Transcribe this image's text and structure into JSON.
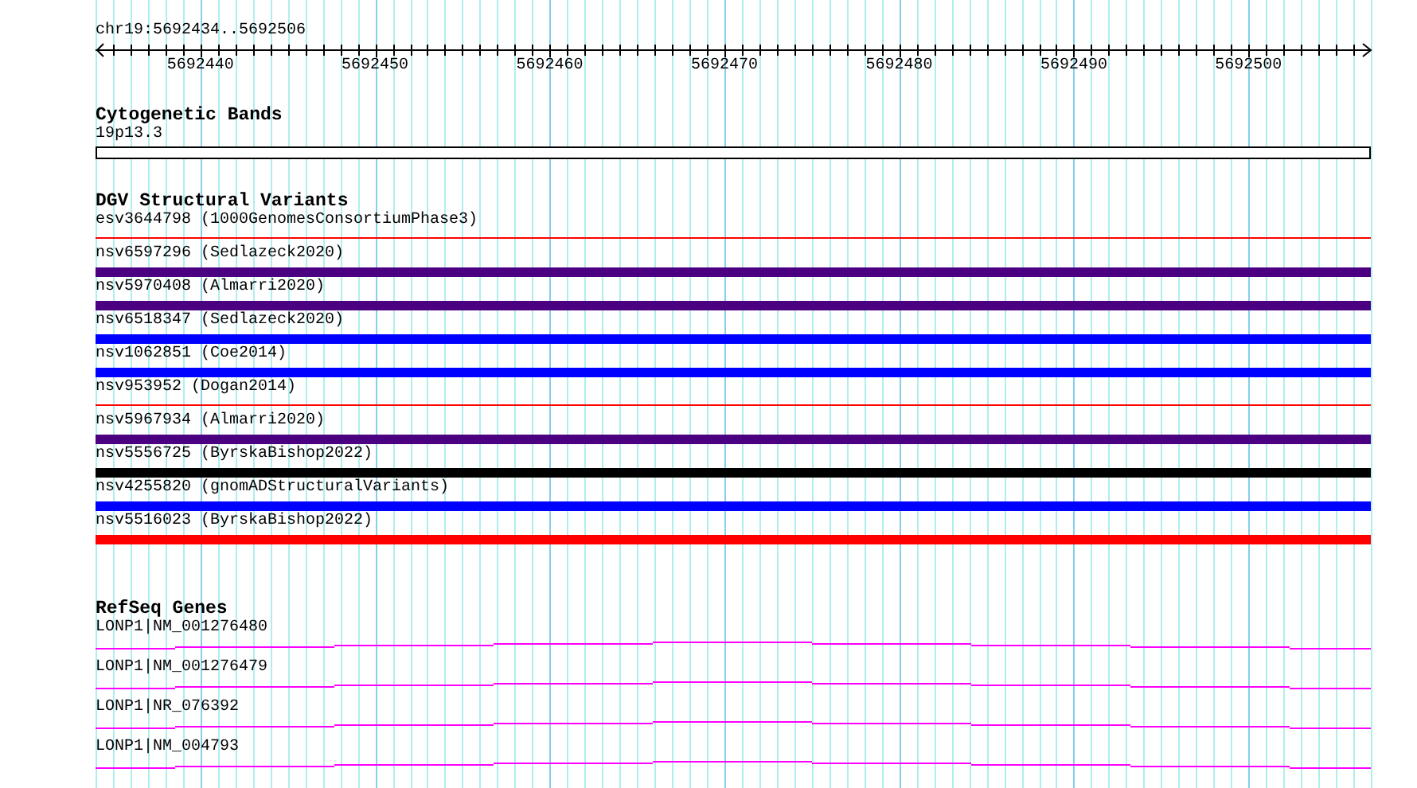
{
  "location": "chr19:5692434..5692506",
  "ruler": {
    "ticks": [
      "5692440",
      "5692450",
      "5692460",
      "5692470",
      "5692480",
      "5692490",
      "5692500"
    ]
  },
  "tracks": [
    {
      "kind": "cytoband",
      "title": "Cytogenetic Bands",
      "features": [
        {
          "label": "19p13.3"
        }
      ]
    },
    {
      "kind": "variants",
      "title": "DGV Structural Variants",
      "features": [
        {
          "label": "esv3644798 (1000GenomesConsortiumPhase3)",
          "kind": "line",
          "color": "#ff0000"
        },
        {
          "label": "nsv6597296 (Sedlazeck2020)",
          "kind": "bar",
          "color": "#4b0082"
        },
        {
          "label": "nsv5970408 (Almarri2020)",
          "kind": "bar",
          "color": "#4b0082"
        },
        {
          "label": "nsv6518347 (Sedlazeck2020)",
          "kind": "bar",
          "color": "#0000ff"
        },
        {
          "label": "nsv1062851 (Coe2014)",
          "kind": "bar",
          "color": "#0000ff"
        },
        {
          "label": "nsv953952 (Dogan2014)",
          "kind": "line",
          "color": "#ff0000"
        },
        {
          "label": "nsv5967934 (Almarri2020)",
          "kind": "bar",
          "color": "#4b0082"
        },
        {
          "label": "nsv5556725 (ByrskaBishop2022)",
          "kind": "bar",
          "color": "#000000"
        },
        {
          "label": "nsv4255820 (gnomADStructuralVariants)",
          "kind": "bar",
          "color": "#0000ff"
        },
        {
          "label": "nsv5516023 (ByrskaBishop2022)",
          "kind": "bar",
          "color": "#ff0000"
        }
      ]
    },
    {
      "kind": "genes",
      "title": "RefSeq Genes",
      "features": [
        {
          "label": "LONP1|NM_001276480"
        },
        {
          "label": "LONP1|NM_001276479"
        },
        {
          "label": "LONP1|NR_076392"
        },
        {
          "label": "LONP1|NM_004793"
        }
      ]
    }
  ]
}
